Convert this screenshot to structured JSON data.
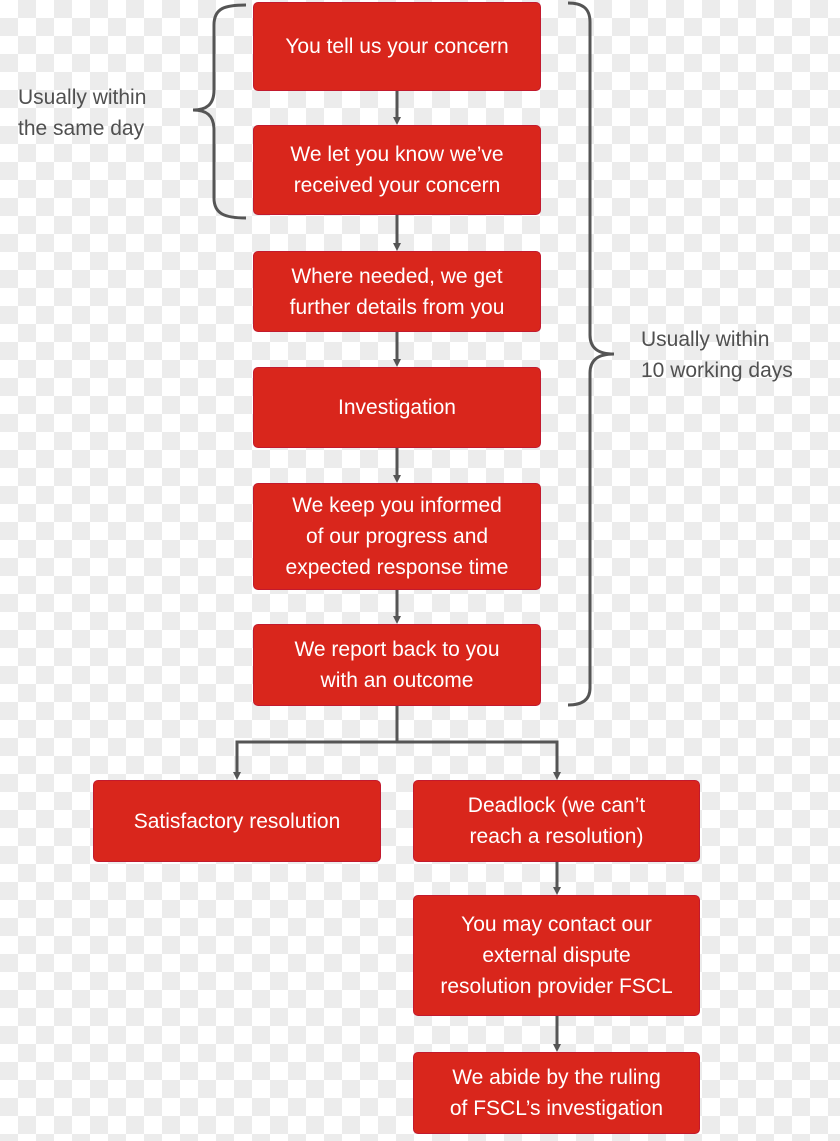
{
  "colors": {
    "box": "#d9261c",
    "connector": "#555555",
    "text": "#ffffff",
    "note": "#505050"
  },
  "steps": [
    "You tell us your concern",
    "We let you know we’ve\nreceived your concern",
    "Where needed, we get\nfurther details from you",
    "Investigation",
    "We keep you informed\nof our progress and\nexpected response time",
    "We report back to you\nwith an outcome"
  ],
  "outcomes": {
    "satisfactory": "Satisfactory resolution",
    "deadlock": "Deadlock (we can’t\nreach a resolution)",
    "contact": "You may contact our\nexternal dispute\nresolution provider FSCL",
    "abide": "We abide by the ruling\nof FSCL’s investigation"
  },
  "notes": {
    "same_day": "Usually within\nthe same day",
    "ten_days": "Usually within\n10 working days"
  }
}
